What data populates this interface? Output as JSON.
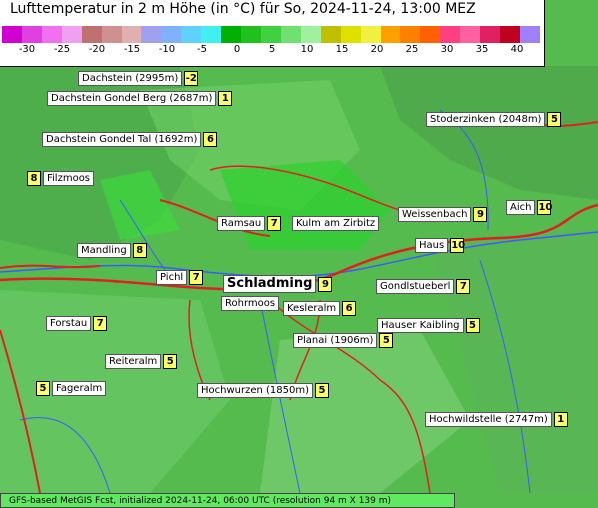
{
  "title": "Lufttemperatur in 2 m Höhe (in °C) für So, 2024-11-24, 13:00 MEZ",
  "colorbar": {
    "ticks": [
      "-30",
      "-25",
      "-20",
      "-15",
      "-10",
      "-5",
      "0",
      "5",
      "10",
      "15",
      "20",
      "25",
      "30",
      "35",
      "40"
    ],
    "colors": [
      "#d000d0",
      "#e040e0",
      "#f070f0",
      "#f0a0f0",
      "#c07070",
      "#d09090",
      "#e0b0b0",
      "#a0a0f0",
      "#80b0ff",
      "#60d0ff",
      "#40f0f0",
      "#00b000",
      "#20c020",
      "#40d040",
      "#70e070",
      "#a0f0a0",
      "#c0c000",
      "#e0e000",
      "#f0f040",
      "#ffa000",
      "#ff8000",
      "#ff6000",
      "#ff4080",
      "#ff60a0",
      "#e02060",
      "#c00020",
      "#a080ff"
    ]
  },
  "places": [
    {
      "name": "Dachstein (2995m)",
      "value": "-2"
    },
    {
      "name": "Dachstein Gondel Berg (2687m)",
      "value": "1"
    },
    {
      "name": "Dachstein Gondel Tal (1692m)",
      "value": "6"
    },
    {
      "name": "Filzmoos",
      "value": "8"
    },
    {
      "name": "Stoderzinken (2048m)",
      "value": "5"
    },
    {
      "name": "Weissenbach",
      "value": "9"
    },
    {
      "name": "Aich",
      "value": "10"
    },
    {
      "name": "Ramsau",
      "value": "7"
    },
    {
      "name": "Kulm am Zirbitz",
      "value": ""
    },
    {
      "name": "Haus",
      "value": "10"
    },
    {
      "name": "Mandling",
      "value": "8"
    },
    {
      "name": "Pichl",
      "value": "7"
    },
    {
      "name": "Schladming",
      "value": "9"
    },
    {
      "name": "Gondlstueberl",
      "value": "7"
    },
    {
      "name": "Rohrmoos",
      "value": ""
    },
    {
      "name": "Kesleralm",
      "value": "6"
    },
    {
      "name": "Forstau",
      "value": "7"
    },
    {
      "name": "Hauser Kaibling",
      "value": "5"
    },
    {
      "name": "Planai (1906m)",
      "value": "5"
    },
    {
      "name": "Reiteralm",
      "value": "5"
    },
    {
      "name": "Fageralm",
      "value": "5"
    },
    {
      "name": "Hochwurzen (1850m)",
      "value": "5"
    },
    {
      "name": "Hochwildstelle (2747m)",
      "value": "1"
    }
  ],
  "footer": "GFS-based MetGIS Fcst, initialized 2024-11-24, 06:00 UTC  (resolution 94 m X 139 m)"
}
